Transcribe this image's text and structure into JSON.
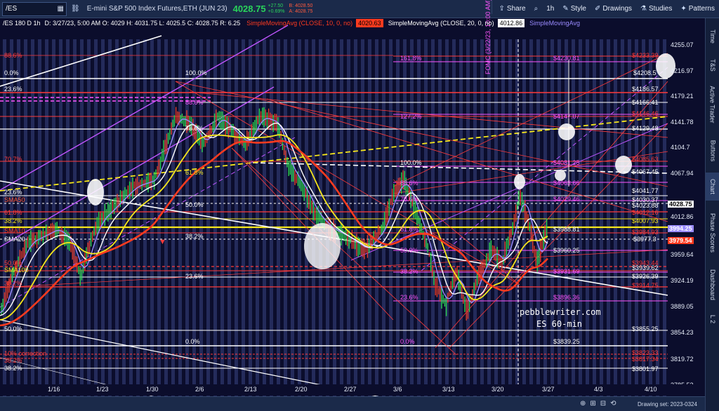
{
  "toolbar": {
    "symbol": "/ES",
    "contract": "E-mini S&P 500 Index Futures,ETH (JUN 23)",
    "last_price": "4028.75",
    "change_points": "+27.50",
    "change_percent": "+0.69%",
    "bid": "B: 4028.50",
    "ask": "A: 4028.75",
    "share_label": "Share",
    "interval_label": "1h",
    "style_label": "Style",
    "drawings_label": "Drawings",
    "studies_label": "Studies",
    "patterns_label": "Patterns"
  },
  "legend": {
    "symbol_info": "/ES 180 D 1h",
    "ohlc": "D: 3/27/23, 5:00 AM  O: 4029  H: 4031.75  L: 4025.5  C: 4028.75  R: 6.25",
    "sma1_label": "SimpleMovingAvg (CLOSE, 10, 0, no)",
    "sma1_value": "4020.63",
    "sma2_label": "SimpleMovingAvg (CLOSE, 20, 0, no)",
    "sma2_value": "4012.86",
    "sma3_label": "SimpleMovingAvg"
  },
  "colors": {
    "background": "#0b0d2c",
    "up_bar": "#2ad14f",
    "down_bar": "#e03a2a",
    "sma10": "#ff3b1f",
    "sma20": "#ffffff",
    "sma50": "#9a8bff",
    "sma100": "#f5e61c",
    "fib_red": "#ff3b3b",
    "fib_magenta": "#ff55ff",
    "channel": "#c055ff"
  },
  "price_axis": {
    "ticks": [
      "4255.07",
      "4216.97",
      "4179.21",
      "4141.78",
      "4104.7",
      "4067.94",
      "4030.5",
      "3994.25",
      "3959.64",
      "3924.19",
      "3889.05",
      "3854.23",
      "3819.72",
      "3785.52"
    ],
    "last_price_tag": "4028.75",
    "tag_4012": "4012.86",
    "tag_3994": "3994.25",
    "tag_3979": "3979.54"
  },
  "time_axis": {
    "labels": [
      "1/16",
      "1/23",
      "1/30",
      "2/6",
      "2/13",
      "2/20",
      "2/27",
      "3/6",
      "3/13",
      "3/20",
      "3/27",
      "4/3",
      "4/10"
    ]
  },
  "fib_labels_left": {
    "f886": "88.6%",
    "f0": "0.0%",
    "f236": "23.6%",
    "f707": "70.7%",
    "f236b": "23.6%",
    "f618": "61.8%",
    "f382": "38.2%",
    "f50": "50.0%",
    "f382b": "38.2%",
    "correction": "10% correction",
    "f382c": "38.2%",
    "f382d": "38.2%"
  },
  "ma_tags": {
    "sma50": "SMA50",
    "sma10": "SMA10",
    "sma20": "SMA20",
    "sma100": "SMA100"
  },
  "fib_labels_mid": {
    "m100": "100.0%",
    "m886": "88.6%",
    "m786": "78.6%",
    "m618": "61.8%",
    "m50": "50.0%",
    "m382": "38.2%",
    "m236": "23.6%",
    "m0": "0.0%"
  },
  "fib_labels_right": {
    "r1618": "161.8%",
    "r1272": "127.2%",
    "r100": "100.0%",
    "r886": "88.6%",
    "r786": "78.6%",
    "r618": "61.8%",
    "r50": "50.0%",
    "r382": "38.2%",
    "r236": "23.6%",
    "r0": "0.0%"
  },
  "price_levels": {
    "p4233": "$4233.39",
    "p4230": "$4230.81",
    "p4208": "$4208.5",
    "p4186": "$4186.57",
    "p4166": "$4166.41",
    "p4147": "$4147.07",
    "p4146": "$4146.46",
    "p4129": "$4129.48",
    "p4085": "$4085.63",
    "p4081": "$4081.25",
    "p4067": "$4067.45",
    "p4063": "$4063.66",
    "p4041": "$4041.77",
    "p4030": "$4030.37",
    "p4029": "$4029.46",
    "p4023": "$4023.88",
    "p4012": "$4012.16",
    "p4007": "$4007.93",
    "p3988": "$3988.81",
    "p3984": "$3984.93",
    "p3977": "$3977.3",
    "p3960": "$3960.25",
    "p3943": "$3943.44",
    "p3939": "$3939.62",
    "p3931": "$3931.69",
    "p3926": "$3926.39",
    "p3914": "$3914.75",
    "p3896": "$3896.36",
    "p3855": "$3855.25",
    "p3839": "$3839.25",
    "p3823": "$3823.33",
    "p3817": "$3817.34",
    "p3801": "$3801.97"
  },
  "annotations": {
    "fomc": "FOMC (3/22/23, 10:00 AM)",
    "site": "pebblewriter.com",
    "subtitle": "ES 60-min"
  },
  "sidebar": {
    "tabs": [
      "Time",
      "T&S",
      "Active Trader",
      "Buttons",
      "Chart",
      "Phase Scores",
      "Dashboard",
      "L 2"
    ]
  },
  "bottom": {
    "drawing_set": "Drawing set: 2023-0324"
  }
}
